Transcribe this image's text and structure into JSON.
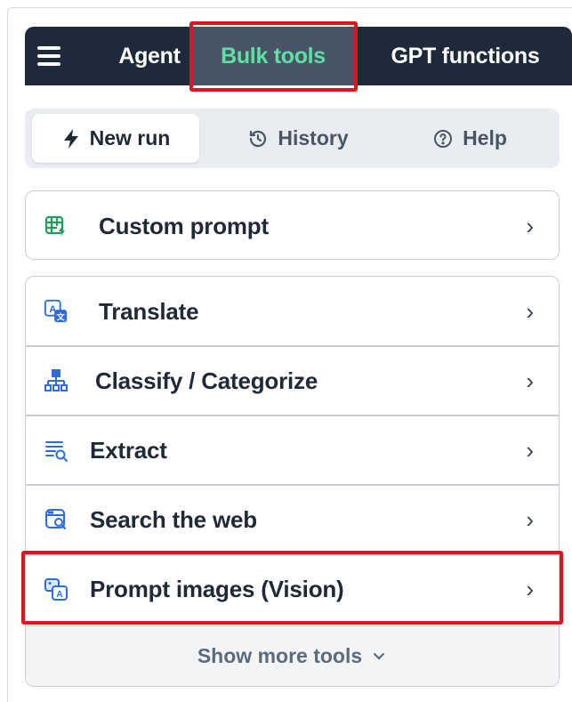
{
  "topnav": {
    "tabs": [
      {
        "label": "Agent"
      },
      {
        "label": "Bulk tools"
      },
      {
        "label": "GPT functions"
      }
    ],
    "active_color": "#5ee0a0",
    "background": "#1e2a3a"
  },
  "segment": {
    "new_run": "New run",
    "history": "History",
    "help": "Help",
    "active": "New run"
  },
  "custom_prompt": {
    "label": "Custom prompt",
    "icon": "table-bolt-icon"
  },
  "tools": [
    {
      "label": "Translate",
      "icon": "translate-icon"
    },
    {
      "label": "Classify / Categorize",
      "icon": "hierarchy-icon"
    },
    {
      "label": "Extract",
      "icon": "extract-search-icon"
    },
    {
      "label": "Search the web",
      "icon": "web-search-icon"
    },
    {
      "label": "Prompt images (Vision)",
      "icon": "image-prompt-icon"
    }
  ],
  "show_more": "Show more tools",
  "highlight_color": "#e0141e"
}
